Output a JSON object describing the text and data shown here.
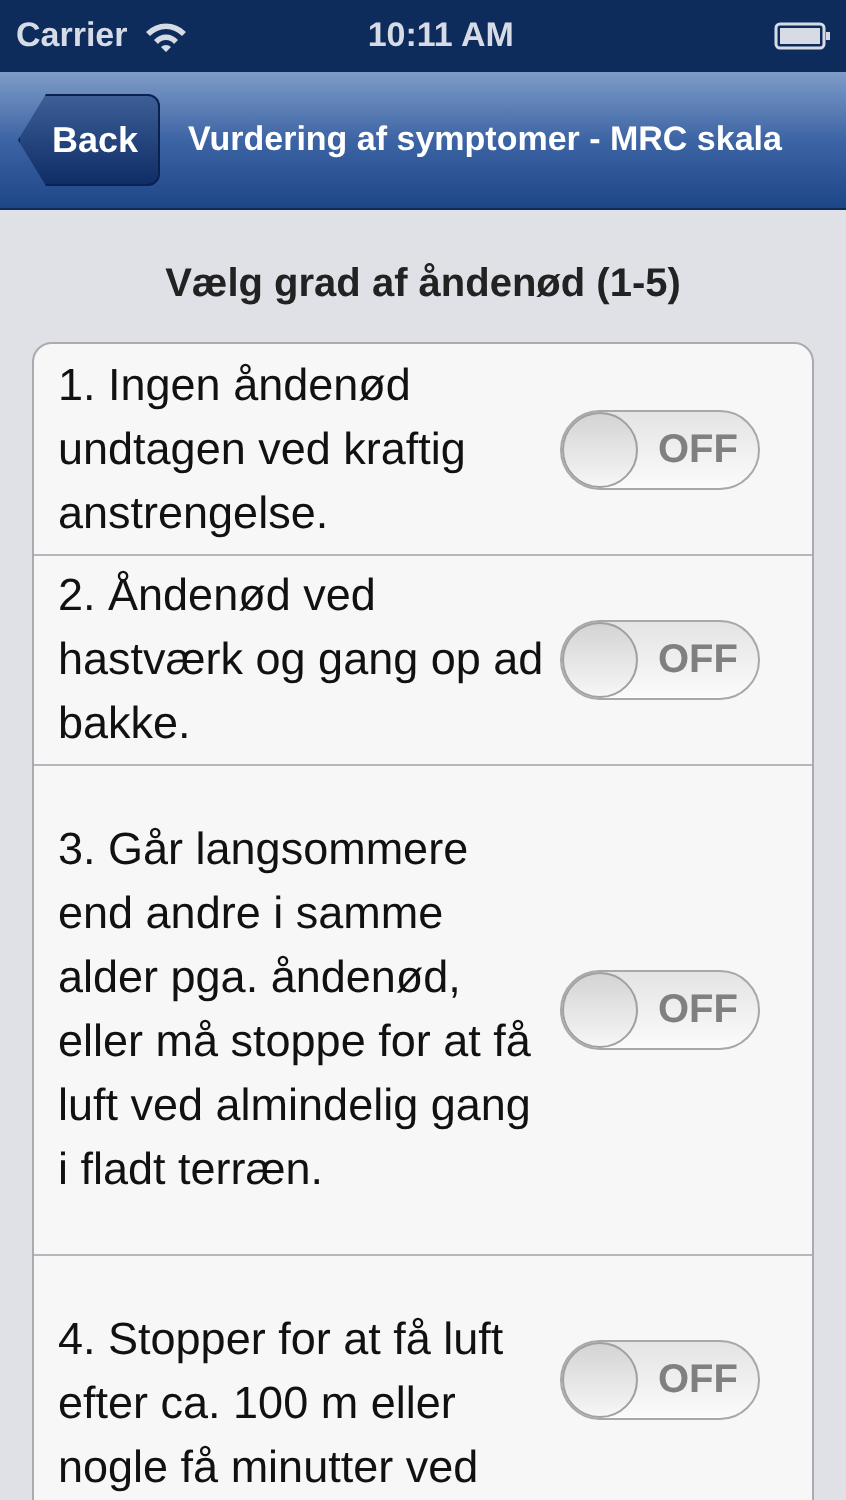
{
  "status_bar": {
    "carrier": "Carrier",
    "time": "10:11 AM"
  },
  "nav_bar": {
    "back": "Back",
    "title": "Vurdering af symptomer - MRC skala"
  },
  "heading": "Vælg grad af åndenød (1-5)",
  "options": [
    {
      "text": "1. Ingen åndenød undtagen ved kraftig anstrengelse.",
      "switch": {
        "label": "OFF",
        "on": false
      }
    },
    {
      "text": "2. Åndenød ved hastværk og gang op ad bakke.",
      "switch": {
        "label": "OFF",
        "on": false
      }
    },
    {
      "text": "3. Går langsommere end andre i samme alder pga. åndenød, eller må stoppe for at få luft ved almindelig gang i fladt terræn.",
      "switch": {
        "label": "OFF",
        "on": false
      }
    },
    {
      "text": "4. Stopper for at få luft efter ca. 100 m eller nogle få minutter ved",
      "switch": {
        "label": "OFF",
        "on": false
      }
    }
  ]
}
